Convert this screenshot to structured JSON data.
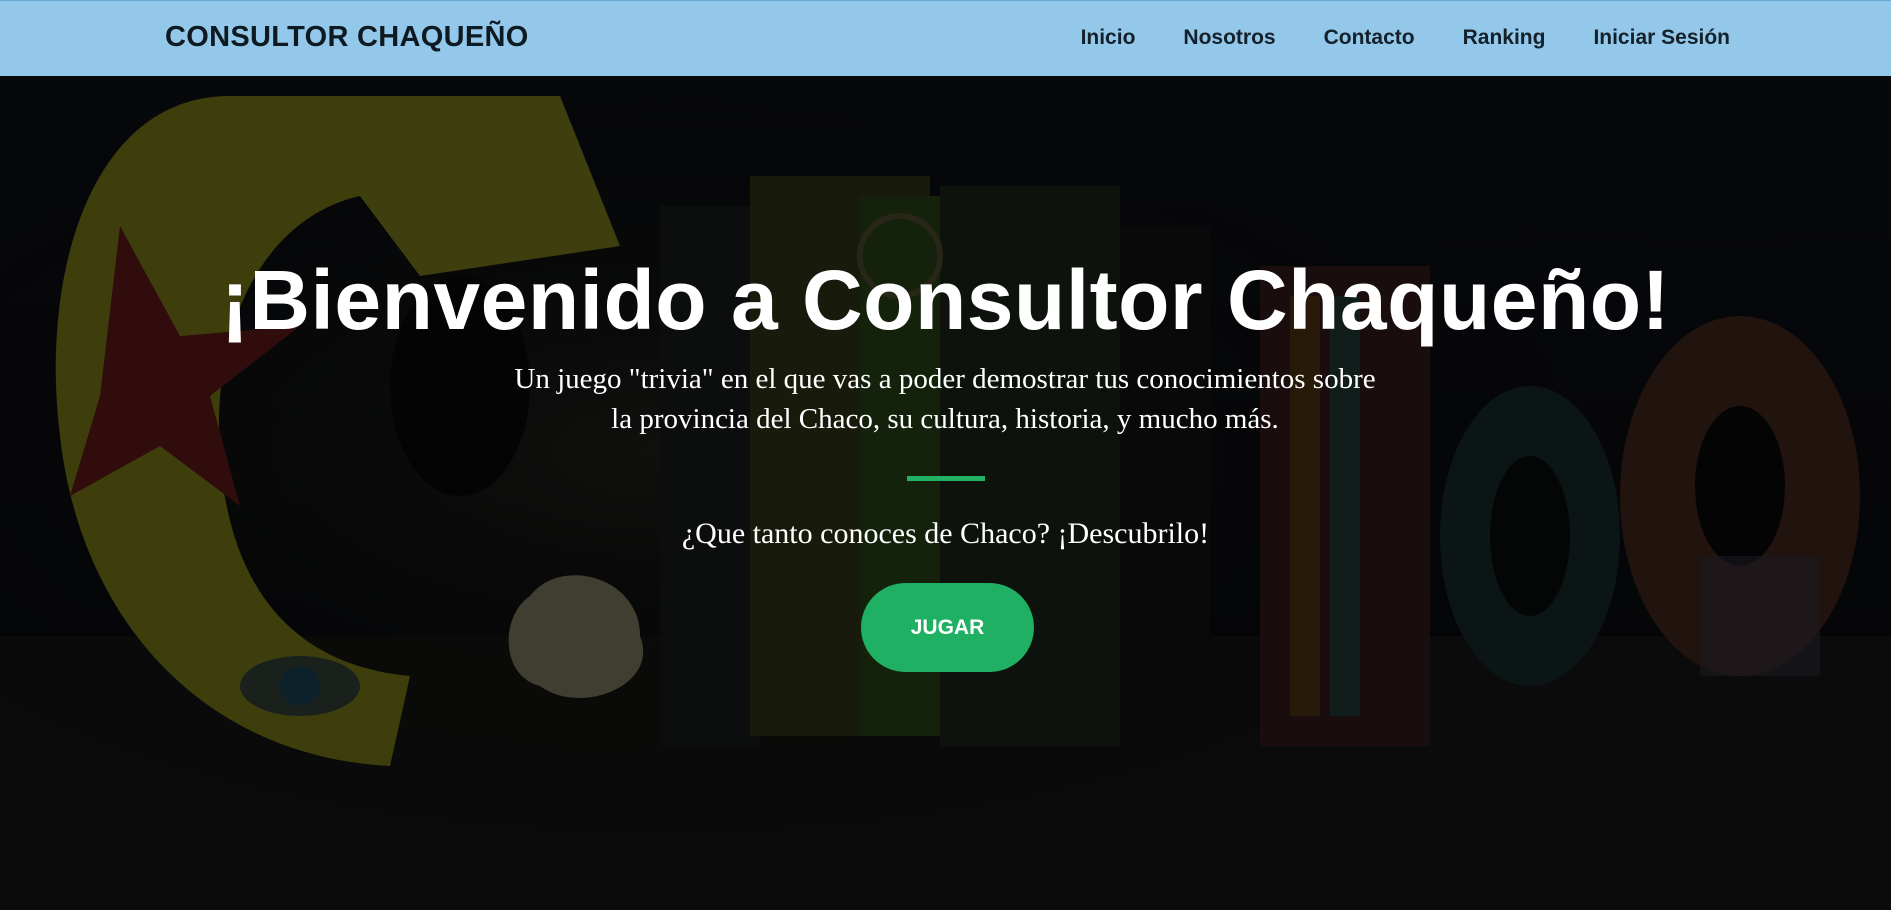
{
  "navbar": {
    "brand": "CONSULTOR CHAQUEÑO",
    "links": [
      {
        "label": "Inicio"
      },
      {
        "label": "Nosotros"
      },
      {
        "label": "Contacto"
      },
      {
        "label": "Ranking"
      },
      {
        "label": "Iniciar Sesión"
      }
    ],
    "background_color": "#93c8ea"
  },
  "hero": {
    "title": "¡Bienvenido a Consultor Chaqueño!",
    "subtitle_line1": "Un juego \"trivia\" en el que vas a poder demostrar tus conocimientos sobre",
    "subtitle_line2": "la provincia del Chaco, su cultura, historia, y mucho más.",
    "question": "¿Que tanto conoces de Chaco? ¡Descubrilo!",
    "play_button": "JUGAR",
    "accent_color": "#1fb063"
  }
}
